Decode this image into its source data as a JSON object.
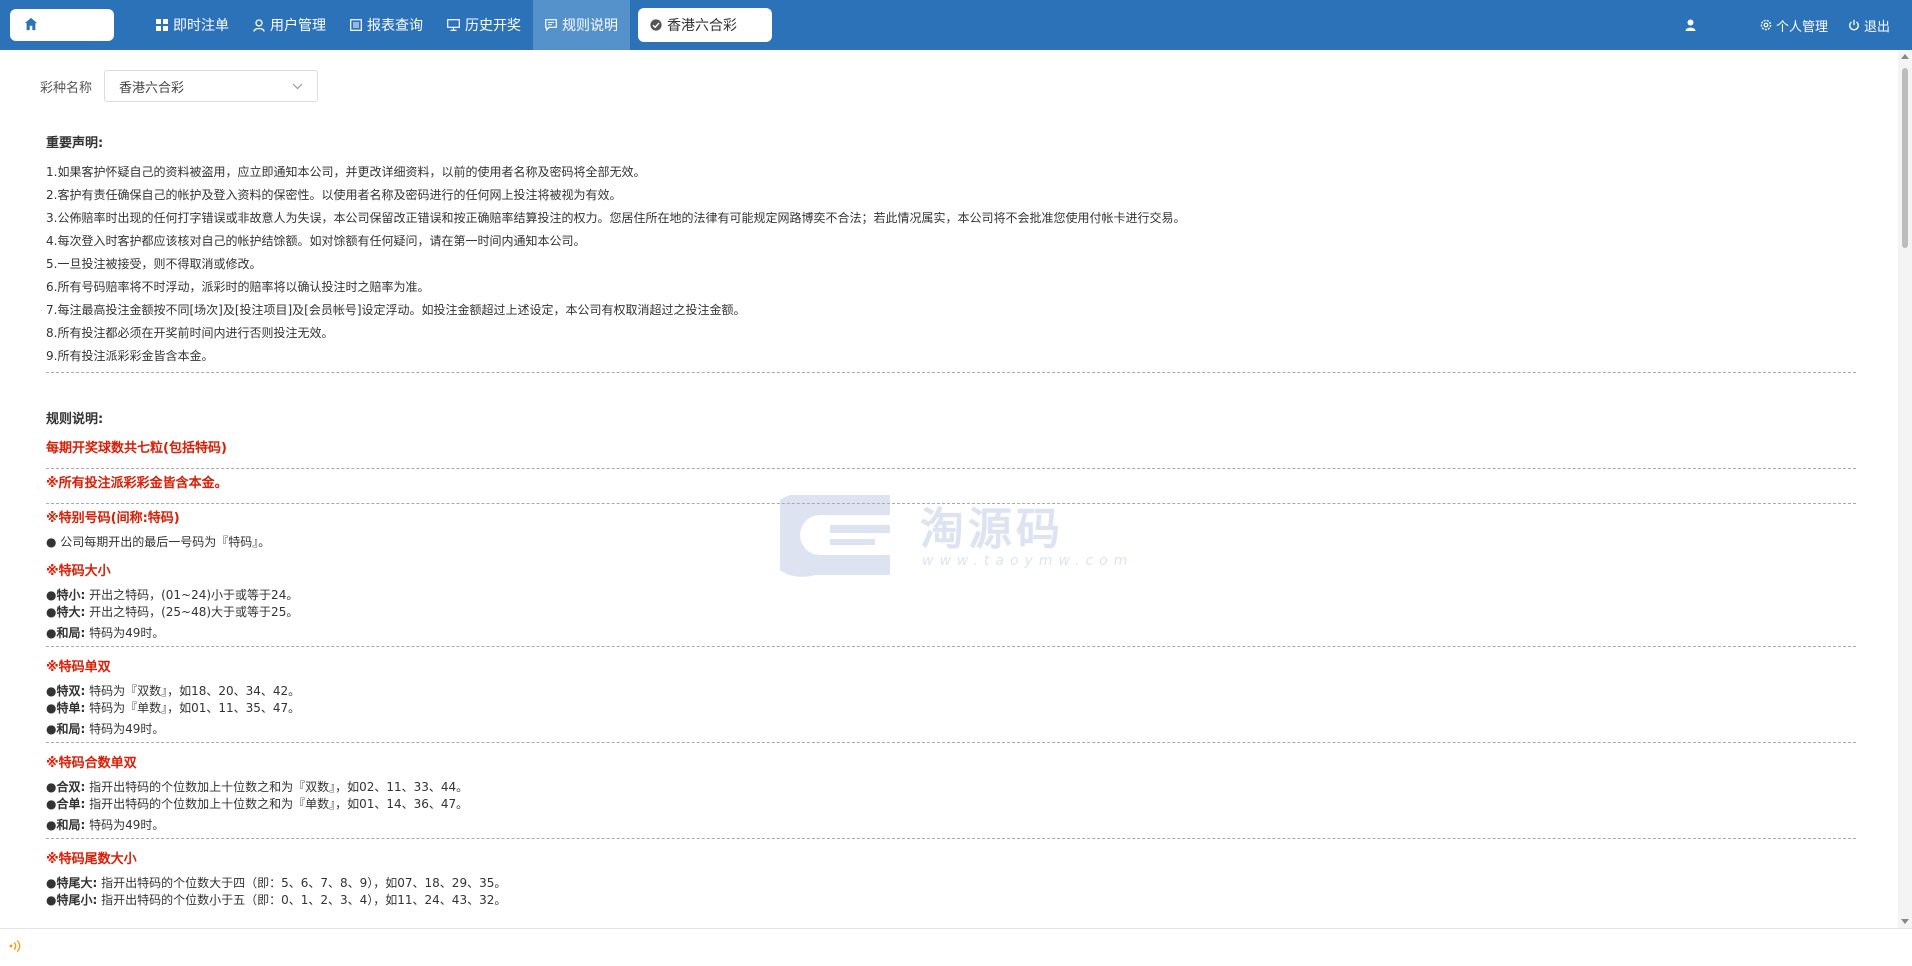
{
  "nav": {
    "items": [
      {
        "label": "即时注单",
        "icon": "grid-icon"
      },
      {
        "label": "用户管理",
        "icon": "user-icon"
      },
      {
        "label": "报表查询",
        "icon": "report-icon"
      },
      {
        "label": "历史开奖",
        "icon": "monitor-icon"
      },
      {
        "label": "规则说明",
        "icon": "message-icon"
      }
    ],
    "selected_game": "香港六合彩"
  },
  "topbar_right": {
    "profile_label": "个人管理",
    "logout_label": "退出"
  },
  "filter": {
    "label": "彩种名称",
    "value": "香港六合彩"
  },
  "notice": {
    "title": "重要声明:",
    "lines": [
      "1.如果客护怀疑自己的资料被盗用，应立即通知本公司，并更改详细资料，以前的使用者名称及密码将全部无效。",
      "2.客护有责任确保自己的帐护及登入资料的保密性。以使用者名称及密码进行的任何网上投注将被视为有效。",
      "3.公佈赔率时出现的任何打字错误或非故意人为失误，本公司保留改正错误和按正确赔率结算投注的权力。您居住所在地的法律有可能规定网路博奕不合法；若此情况属实，本公司将不会批准您使用付帐卡进行交易。",
      "4.每次登入时客护都应该核对自己的帐护结馀额。如对馀额有任何疑问，请在第一时间内通知本公司。",
      "5.一旦投注被接受，则不得取消或修改。",
      "6.所有号码赔率将不时浮动，派彩时的赔率将以确认投注时之赔率为准。",
      "7.每注最高投注金额按不同[场次]及[投注项目]及[会员帐号]设定浮动。如投注金额超过上述设定，本公司有权取消超过之投注金额。",
      "8.所有投注都必须在开奖前时间内进行否则投注无效。",
      "9.所有投注派彩彩金皆含本金。"
    ]
  },
  "rules": {
    "title": "规则说明:",
    "intro1": "每期开奖球数共七粒(包括特码)",
    "intro2": "※所有投注派彩彩金皆含本金。",
    "special": {
      "title": "※特别号码(间称:特码)",
      "line": "● 公司每期开出的最后一号码为『特码』。"
    },
    "size": {
      "title": "※特码大小",
      "l1_key": "●特小:",
      "l1_val": " 开出之特码，(01~24)小于或等于24。",
      "l2_key": "●特大:",
      "l2_val": " 开出之特码，(25~48)大于或等于25。",
      "l3_key": "●和局:",
      "l3_val": " 特码为49时。"
    },
    "oddeven": {
      "title": "※特码单双",
      "l1_key": "●特双:",
      "l1_val": " 特码为『双数』，如18、20、34、42。",
      "l2_key": "●特单:",
      "l2_val": " 特码为『单数』，如01、11、35、47。",
      "l3_key": "●和局:",
      "l3_val": " 特码为49时。"
    },
    "sumoddeven": {
      "title": "※特码合数单双",
      "l1_key": "●合双:",
      "l1_val": " 指开出特码的个位数加上十位数之和为『双数』，如02、11、33、44。",
      "l2_key": "●合单:",
      "l2_val": " 指开出特码的个位数加上十位数之和为『单数』，如01、14、36、47。",
      "l3_key": "●和局:",
      "l3_val": " 特码为49时。"
    },
    "tailsize": {
      "title": "※特码尾数大小",
      "l1_key": "●特尾大:",
      "l1_val": " 指开出特码的个位数大于四（即：5、6、7、8、9），如07、18、29、35。",
      "l2_key": "●特尾小:",
      "l2_val": " 指开出特码的个位数小于五（即：0、1、2、3、4），如11、24、43、32。"
    }
  },
  "watermark": {
    "text": "淘源码",
    "sub": "www.taoymw.com"
  },
  "colors": {
    "topbar": "#2b72b9",
    "active_tab": "#5592cc",
    "rule_red": "#d81e06"
  }
}
